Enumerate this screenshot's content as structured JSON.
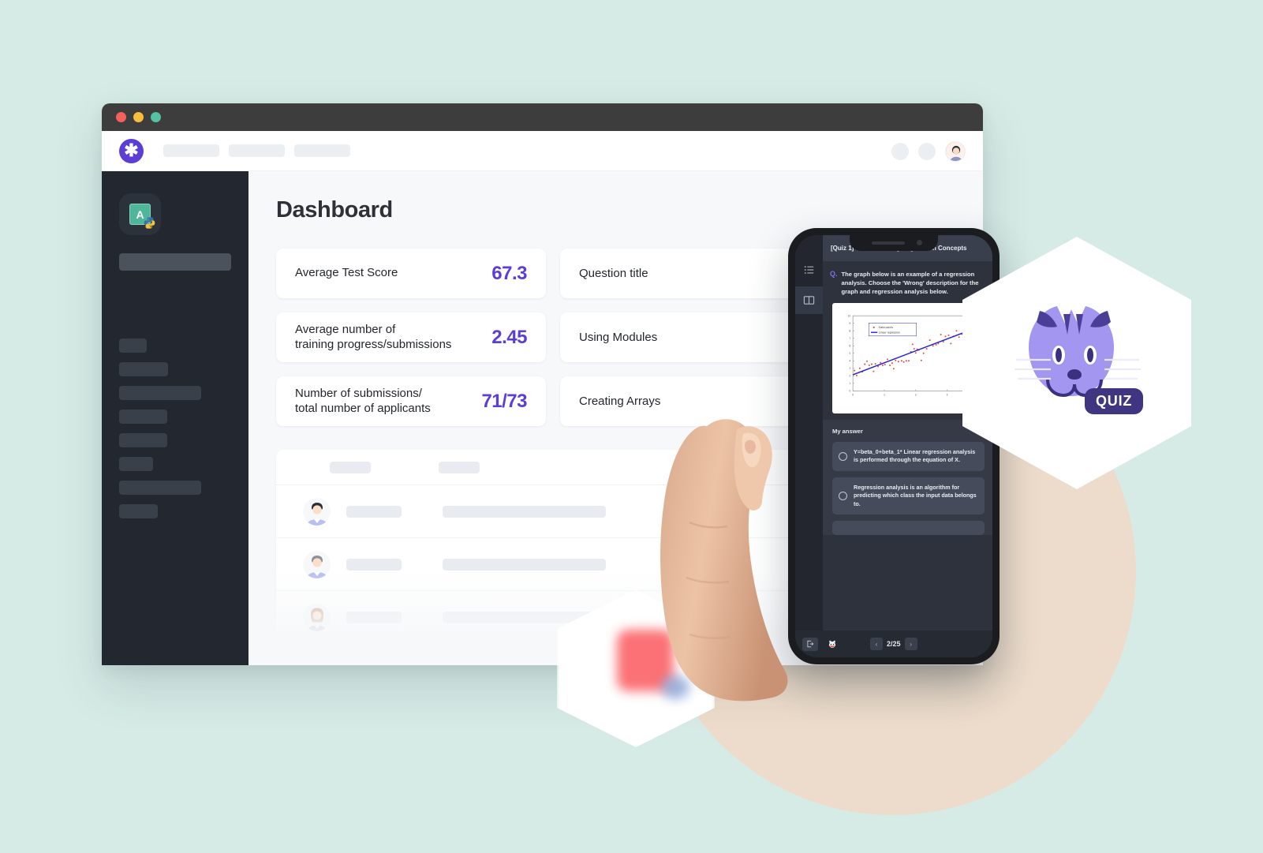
{
  "background_color": "#d6ebe5",
  "accent_color": "#5a3ed6",
  "browser": {
    "traffic_lights": [
      "close",
      "minimize",
      "maximize"
    ],
    "brand_logo_glyph": "✱",
    "nav_placeholders": 3
  },
  "sidebar": {
    "course_badge_letter": "A",
    "skeleton_item_widths": [
      30,
      52,
      75,
      51,
      51,
      36,
      75,
      41
    ]
  },
  "main": {
    "page_title": "Dashboard",
    "stats": [
      {
        "label": "Average Test Score",
        "value": "67.3"
      },
      {
        "label": "Average number of\ntraining progress/submissions",
        "value": "2.45"
      },
      {
        "label": "Number of submissions/\ntotal number of applicants",
        "value": "71/73"
      }
    ],
    "questions": [
      {
        "label": "Question title"
      },
      {
        "label": "Using Modules"
      },
      {
        "label": "Creating Arrays"
      }
    ],
    "table": {
      "header_skeletons": 2,
      "rows": 4
    }
  },
  "phone": {
    "rail_icons": [
      "list-icon",
      "book-icon"
    ],
    "quiz_title": "[Quiz 1] Understanding Regression Concepts",
    "question_marker": "Q.",
    "question_text": "The graph below is an example of a regression analysis. Choose the 'Wrong' description for the graph and regression analysis below.",
    "answer_label": "My answer",
    "answers": [
      "Y=beta_0+beta_1* Linear regression analysis is performed through the equation of X.",
      "Regression analysis is an algorithm for predicting which class the input data belongs to."
    ],
    "bottom_bar": {
      "exit_icon": "exit-icon",
      "mascot_icon": "cat-mascot-icon",
      "prev_label": "‹",
      "next_label": "›",
      "page_counter": "2/25"
    }
  },
  "hex_logo": {
    "badge_text": "QUIZ",
    "cat_color": "#a396f0",
    "badge_color": "#3f3580"
  },
  "chart_data": {
    "type": "scatter",
    "title": "",
    "xlabel": "",
    "ylabel": "",
    "xlim": [
      0,
      4
    ],
    "ylim": [
      0,
      10
    ],
    "xticks": [
      0,
      1,
      2,
      3
    ],
    "yticks": [
      0,
      1,
      2,
      3,
      4,
      5,
      6,
      7,
      8,
      9,
      10
    ],
    "grid": false,
    "legend": {
      "position": "upper-left",
      "entries": [
        "Data points",
        "Linear regression"
      ]
    },
    "series": [
      {
        "name": "Data points",
        "type": "scatter",
        "color": "#e8473f",
        "points": [
          [
            0.05,
            2.7
          ],
          [
            0.12,
            2.05
          ],
          [
            0.22,
            3.0
          ],
          [
            0.3,
            2.55
          ],
          [
            0.38,
            3.55
          ],
          [
            0.45,
            3.95
          ],
          [
            0.52,
            3.4
          ],
          [
            0.6,
            3.55
          ],
          [
            0.66,
            2.6
          ],
          [
            0.72,
            3.6
          ],
          [
            0.8,
            3.25
          ],
          [
            0.88,
            3.75
          ],
          [
            0.95,
            3.4
          ],
          [
            1.02,
            3.5
          ],
          [
            1.1,
            4.2
          ],
          [
            1.18,
            3.4
          ],
          [
            1.25,
            3.7
          ],
          [
            1.3,
            2.95
          ],
          [
            1.36,
            4.05
          ],
          [
            1.45,
            3.9
          ],
          [
            1.55,
            4.0
          ],
          [
            1.62,
            3.85
          ],
          [
            1.7,
            4.0
          ],
          [
            1.78,
            4.0
          ],
          [
            1.85,
            5.2
          ],
          [
            1.9,
            6.2
          ],
          [
            1.95,
            5.6
          ],
          [
            2.0,
            5.05
          ],
          [
            2.05,
            5.55
          ],
          [
            2.1,
            5.45
          ],
          [
            2.18,
            4.05
          ],
          [
            2.25,
            5.0
          ],
          [
            2.35,
            5.6
          ],
          [
            2.45,
            6.75
          ],
          [
            2.55,
            6.0
          ],
          [
            2.65,
            6.15
          ],
          [
            2.72,
            6.3
          ],
          [
            2.8,
            7.5
          ],
          [
            2.88,
            6.55
          ],
          [
            2.95,
            7.25
          ],
          [
            3.05,
            7.4
          ],
          [
            3.12,
            6.3
          ],
          [
            3.2,
            7.25
          ],
          [
            3.3,
            8.0
          ],
          [
            3.38,
            7.15
          ],
          [
            3.48,
            7.55
          ],
          [
            3.6,
            7.6
          ],
          [
            3.72,
            8.5
          ],
          [
            3.8,
            7.95
          ],
          [
            3.9,
            8.4
          ]
        ]
      },
      {
        "name": "Linear regression",
        "type": "line",
        "color": "#1f1fd8",
        "points": [
          [
            0,
            2.15
          ],
          [
            4,
            8.5
          ]
        ]
      }
    ]
  }
}
